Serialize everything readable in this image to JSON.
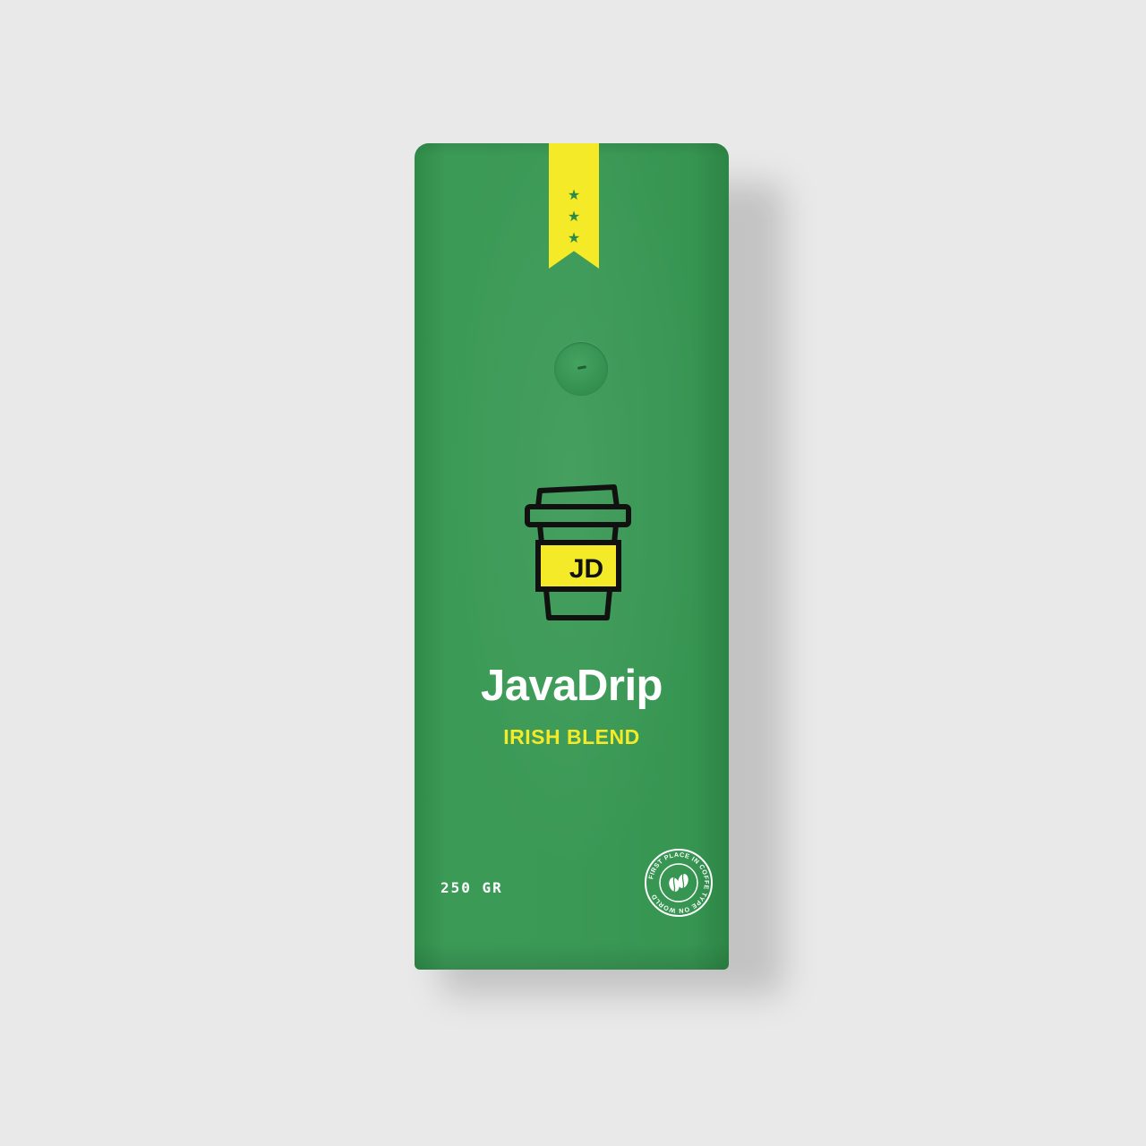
{
  "product": {
    "brand_name": "JavaDrip",
    "blend_name": "IRISH BLEND",
    "weight": "250 GR",
    "cup_logo_text": "JD",
    "badge_text": "FIRST PLACE IN COFFE TYPE ON WORLD",
    "ribbon_stars": [
      "★",
      "★",
      "★"
    ]
  },
  "colors": {
    "background": "#e9e9ea",
    "bag_green": "#3a9955",
    "accent_yellow": "#f4ea27",
    "text_white": "#ffffff",
    "outline_black": "#111111"
  },
  "icons": {
    "ribbon_star": "star-icon",
    "cup": "coffee-cup-icon",
    "badge_bean": "coffee-bean-icon"
  }
}
